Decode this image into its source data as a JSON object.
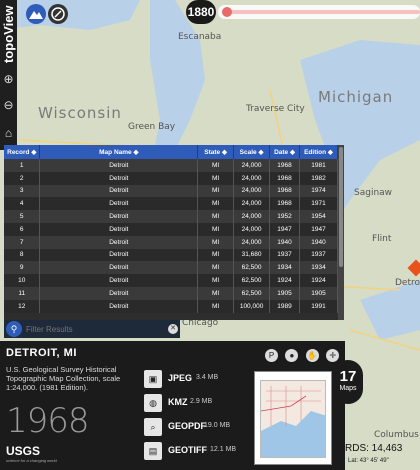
{
  "app": {
    "logo": "topoView"
  },
  "year_slider": {
    "year": "1880"
  },
  "map_labels": {
    "escanaba": "Escanaba",
    "wisconsin": "Wisconsin",
    "michigan": "Michigan",
    "green_bay": "Green Bay",
    "traverse_city": "Traverse City",
    "saginaw": "Saginaw",
    "flint": "Flint",
    "detroit": "Detroit",
    "chicago": "Chicago",
    "columbus": "Columbus"
  },
  "table": {
    "headers": {
      "record": "Record",
      "name": "Map Name",
      "state": "State",
      "scale": "Scale",
      "date": "Date",
      "edition": "Edition"
    },
    "rows": [
      {
        "record": "1",
        "name": "Detroit",
        "state": "MI",
        "scale": "24,000",
        "date": "1968",
        "edition": "1981"
      },
      {
        "record": "2",
        "name": "Detroit",
        "state": "MI",
        "scale": "24,000",
        "date": "1968",
        "edition": "1982"
      },
      {
        "record": "3",
        "name": "Detroit",
        "state": "MI",
        "scale": "24,000",
        "date": "1968",
        "edition": "1974"
      },
      {
        "record": "4",
        "name": "Detroit",
        "state": "MI",
        "scale": "24,000",
        "date": "1968",
        "edition": "1971"
      },
      {
        "record": "5",
        "name": "Detroit",
        "state": "MI",
        "scale": "24,000",
        "date": "1952",
        "edition": "1954"
      },
      {
        "record": "6",
        "name": "Detroit",
        "state": "MI",
        "scale": "24,000",
        "date": "1947",
        "edition": "1947"
      },
      {
        "record": "7",
        "name": "Detroit",
        "state": "MI",
        "scale": "24,000",
        "date": "1940",
        "edition": "1940"
      },
      {
        "record": "8",
        "name": "Detroit",
        "state": "MI",
        "scale": "31,680",
        "date": "1937",
        "edition": "1937"
      },
      {
        "record": "9",
        "name": "Detroit",
        "state": "MI",
        "scale": "62,500",
        "date": "1934",
        "edition": "1934"
      },
      {
        "record": "10",
        "name": "Detroit",
        "state": "MI",
        "scale": "62,500",
        "date": "1924",
        "edition": "1924"
      },
      {
        "record": "11",
        "name": "Detroit",
        "state": "MI",
        "scale": "62,500",
        "date": "1905",
        "edition": "1905"
      },
      {
        "record": "12",
        "name": "Detroit",
        "state": "MI",
        "scale": "100,000",
        "date": "1989",
        "edition": "1991"
      }
    ]
  },
  "filter": {
    "placeholder": "Filter Results"
  },
  "detail": {
    "title": "DETROIT, MI",
    "description": "U.S. Geological Survey Historical Topographic Map Collection, scale 1:24,000. (1981 Edition).",
    "year": "1968",
    "usgs_logo": "USGS",
    "usgs_tagline": "science for a changing world",
    "downloads": [
      {
        "format": "JPEG",
        "size": "3.4 MB",
        "icon": "image-icon"
      },
      {
        "format": "KMZ",
        "size": "2.9 MB",
        "icon": "globe-icon"
      },
      {
        "format": "GEOPDF",
        "size": "19.0 MB",
        "icon": "pdf-icon"
      },
      {
        "format": "GEOTIFF",
        "size": "12.1 MB",
        "icon": "file-icon"
      }
    ]
  },
  "maps_bubble": {
    "count": "17",
    "label": "Maps"
  },
  "footer": {
    "records": "RDS: 14,463",
    "coords": "Lat: 43° 45' 49\""
  },
  "colors": {
    "header_blue": "#2e5cb8",
    "accent_red": "#e96a6a",
    "marker_orange": "#e8521d"
  }
}
